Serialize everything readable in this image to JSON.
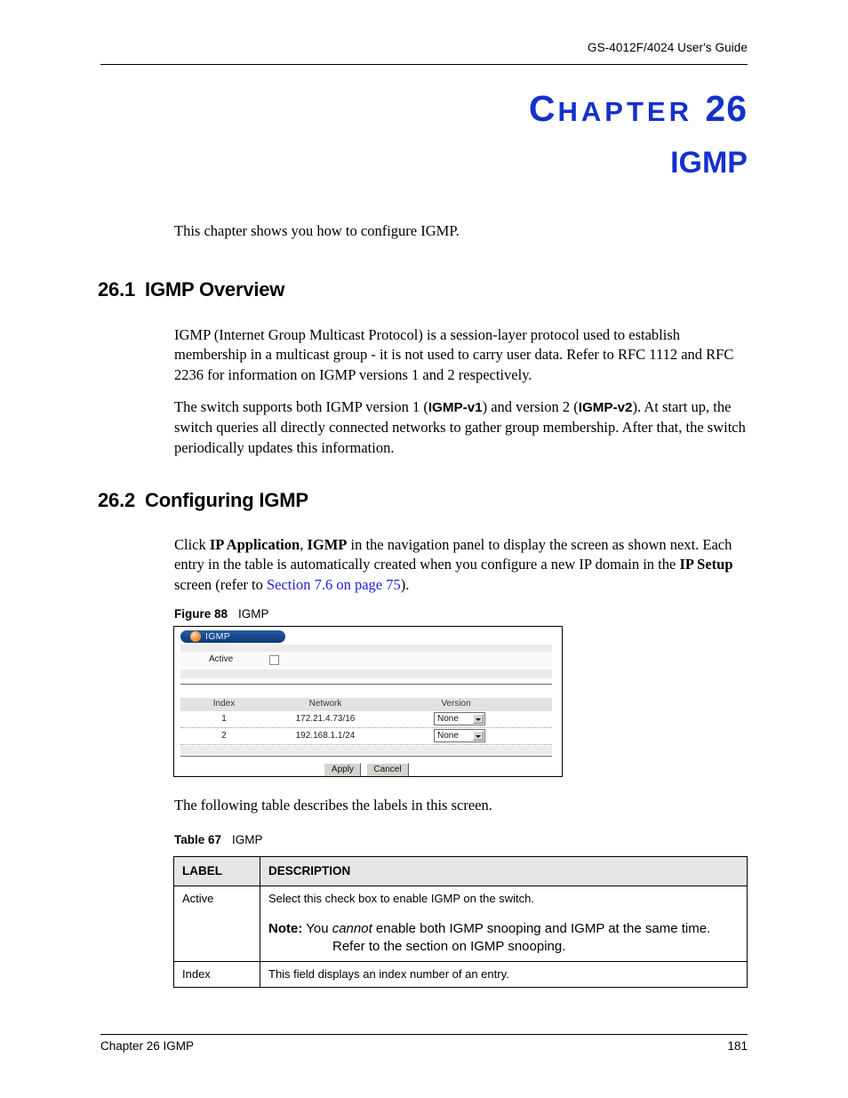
{
  "header": {
    "running_title": "GS-4012F/4024 User's Guide"
  },
  "chapter": {
    "label_first": "C",
    "label_rest": "HAPTER",
    "number": "26",
    "name": "IGMP"
  },
  "intro": "This chapter shows you how to configure IGMP.",
  "sections": {
    "overview": {
      "number": "26.1",
      "title": "IGMP Overview",
      "para1": "IGMP (Internet Group Multicast Protocol) is a session-layer protocol used to establish membership in a multicast group - it is not used to carry user data. Refer to RFC 1112 and RFC 2236 for information on IGMP versions 1 and 2 respectively.",
      "para2_a": "The switch supports both IGMP version 1 (",
      "para2_b": "IGMP-v1",
      "para2_c": ") and version 2 (",
      "para2_d": "IGMP-v2",
      "para2_e": ").  At start up, the switch queries all directly connected networks to gather group membership.  After that, the switch periodically updates this information."
    },
    "configuring": {
      "number": "26.2",
      "title": "Configuring IGMP",
      "para_a": "Click ",
      "para_b": "IP Application",
      "para_c": ", ",
      "para_d": "IGMP",
      "para_e": " in the navigation panel to display the screen as shown next. Each entry in the table is automatically created when you configure a new IP domain in the ",
      "para_f": "IP Setup",
      "para_g": " screen (refer to ",
      "para_link": "Section 7.6 on page 75",
      "para_h": ")."
    }
  },
  "figure": {
    "caption_label": "Figure 88",
    "caption_text": "IGMP",
    "screenshot": {
      "window_title": "IGMP",
      "icon": "orange-sphere-icon",
      "active_label": "Active",
      "active_checked": false,
      "table_headers": [
        "Index",
        "Network",
        "Version"
      ],
      "rows": [
        {
          "index": "1",
          "network": "172.21.4.73/16",
          "version": "None"
        },
        {
          "index": "2",
          "network": "192.168.1.1/24",
          "version": "None"
        }
      ],
      "buttons": {
        "apply": "Apply",
        "cancel": "Cancel"
      },
      "colors": {
        "titlebar": "#174a8f",
        "icon": "#f6a04a",
        "strip": "#eceaea",
        "header_row": "#e3e1e1"
      }
    }
  },
  "table_intro": "The following table describes the labels in this screen.",
  "table": {
    "caption_label": "Table 67",
    "caption_text": "IGMP",
    "headers": [
      "LABEL",
      "DESCRIPTION"
    ],
    "rows": [
      {
        "label": "Active",
        "description": "Select this check box to enable IGMP on the switch.",
        "note_keyword": "Note:",
        "note_before_em": " You ",
        "note_em": "cannot",
        "note_after_em": " enable both IGMP snooping and IGMP at the same time. Refer to the section on IGMP snooping."
      },
      {
        "label": "Index",
        "description": "This field displays an index number of an entry."
      }
    ]
  },
  "footer": {
    "left": "Chapter 26 IGMP",
    "right": "181"
  }
}
